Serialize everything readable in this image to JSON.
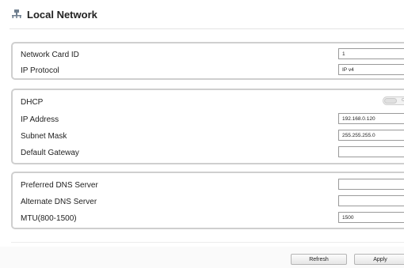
{
  "header": {
    "title": "Local Network",
    "icon": "network-icon"
  },
  "group1": {
    "network_card_id": {
      "label": "Network Card ID",
      "value": "1"
    },
    "ip_protocol": {
      "label": "IP Protocol",
      "value": "IP v4"
    }
  },
  "group2": {
    "dhcp": {
      "label": "DHCP",
      "state": "OFF"
    },
    "ip_address": {
      "label": "IP Address",
      "value": "192.168.0.120"
    },
    "subnet_mask": {
      "label": "Subnet Mask",
      "value": "255.255.255.0"
    },
    "default_gateway": {
      "label": "Default Gateway",
      "value": ""
    }
  },
  "group3": {
    "preferred_dns": {
      "label": "Preferred DNS Server",
      "value": ""
    },
    "alternate_dns": {
      "label": "Alternate DNS Server",
      "value": ""
    },
    "mtu": {
      "label": "MTU(800-1500)",
      "value": "1500"
    }
  },
  "footer": {
    "refresh_label": "Refresh",
    "apply_label": "Apply"
  },
  "colors": {
    "panel_border": "#cfcfcf",
    "text": "#1a1a1a"
  }
}
